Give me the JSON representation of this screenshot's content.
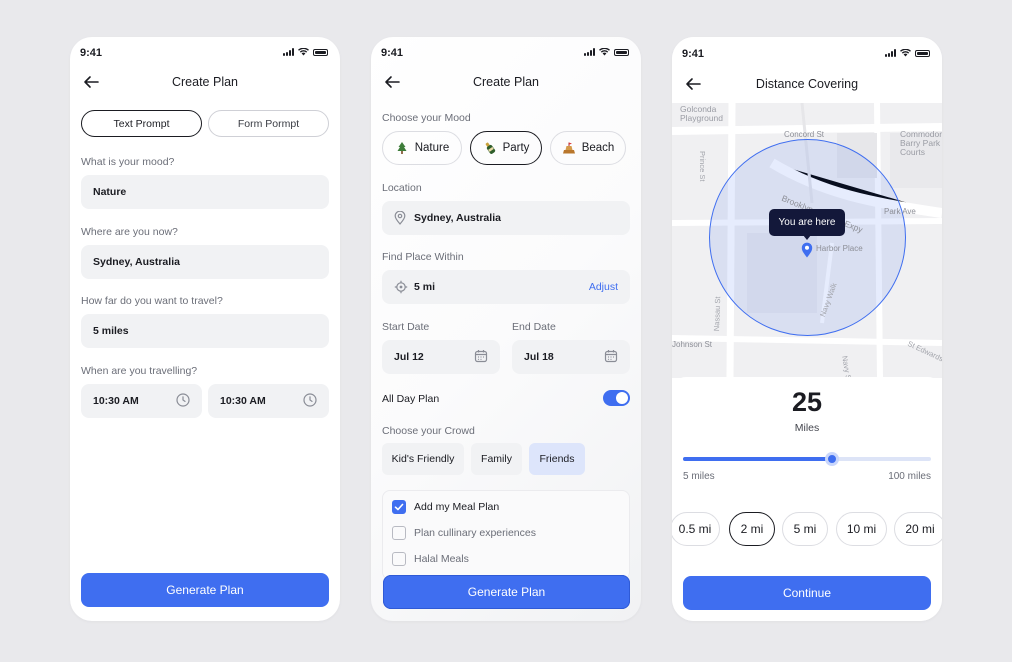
{
  "status_time": "9:41",
  "screen1": {
    "title": "Create Plan",
    "tabs": [
      "Text Prompt",
      "Form Pormpt"
    ],
    "fields": [
      {
        "label": "What is your mood?",
        "value": "Nature"
      },
      {
        "label": "Where are you now?",
        "value": "Sydney, Australia"
      },
      {
        "label": "How far do you want to travel?",
        "value": "5 miles"
      }
    ],
    "travel_label": "When are you travelling?",
    "times": [
      "10:30 AM",
      "10:30 AM"
    ],
    "button": "Generate Plan"
  },
  "screen2": {
    "title": "Create Plan",
    "mood_label": "Choose your Mood",
    "moods": [
      {
        "label": "Nature",
        "icon": "tree-icon"
      },
      {
        "label": "Party",
        "icon": "bottle-icon",
        "selected": true
      },
      {
        "label": "Beach",
        "icon": "sandcastle-icon"
      }
    ],
    "location_label": "Location",
    "location": "Sydney, Australia",
    "within_label": "Find Place Within",
    "within_value": "5 mi",
    "adjust": "Adjust",
    "start_label": "Start Date",
    "start_value": "Jul 12",
    "end_label": "End Date",
    "end_value": "Jul 18",
    "allday_label": "All Day Plan",
    "allday_on": true,
    "crowd_label": "Choose your Crowd",
    "crowds": [
      "Kid's Friendly",
      "Family",
      "Friends"
    ],
    "crowd_selected": "Friends",
    "options": [
      {
        "label": "Add my Meal Plan",
        "checked": true
      },
      {
        "label": "Plan cullinary experiences",
        "checked": false
      },
      {
        "label": "Halal Meals",
        "checked": false
      }
    ],
    "button": "Generate Plan"
  },
  "screen3": {
    "title": "Distance Covering",
    "map_labels": [
      "Golconda Playground",
      "Concord St",
      "Commodore Barry Park Courts",
      "Prince St",
      "Brooklyn Queens Expy",
      "Park Ave",
      "Harbor Place",
      "Navy Walk",
      "Johnson St",
      "Navy St",
      "Nassau St",
      "St Edwards St"
    ],
    "tooltip": "You are here",
    "distance": "25",
    "unit": "Miles",
    "slider_fraction": 0.6,
    "min_label": "5 miles",
    "max_label": "100 miles",
    "options": [
      "0.5 mi",
      "2 mi",
      "5 mi",
      "10 mi",
      "20 mi"
    ],
    "option_selected": "2 mi",
    "button": "Continue",
    "accent": "#3f6ef0"
  }
}
